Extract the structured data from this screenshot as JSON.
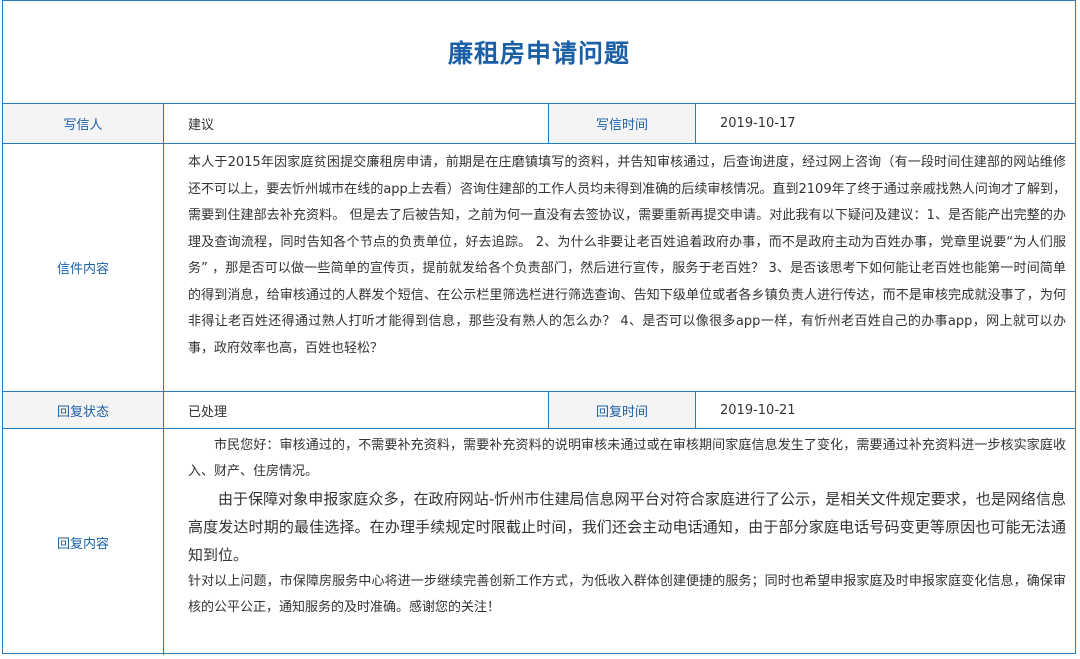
{
  "title": "廉租房申请问题",
  "writer": {
    "label": "写信人",
    "value": "建议",
    "time_label": "写信时间",
    "time_value": "2019-10-17"
  },
  "letter": {
    "label": "信件内容",
    "text": "本人于2015年因家庭贫困提交廉租房申请，前期是在庄磨镇填写的资料，并告知审核通过，后查询进度，经过网上咨询（有一段时间住建部的网站维修还不可以上，要去忻州城市在线的app上去看）咨询住建部的工作人员均未得到准确的后续审核情况。直到2109年了终于通过亲戚找熟人问询才了解到，需要到住建部去补充资料。 但是去了后被告知，之前为何一直没有去签协议，需要重新再提交申请。对此我有以下疑问及建议：1、是否能产出完整的办理及查询流程，同时告知各个节点的负责单位，好去追踪。 2、为什么非要让老百姓追着政府办事，而不是政府主动为百姓办事，党章里说要“为人们服务” ，那是否可以做一些简单的宣传页，提前就发给各个负责部门，然后进行宣传，服务于老百姓？ 3、是否该思考下如何能让老百姓也能第一时间简单的得到消息，给审核通过的人群发个短信、在公示栏里筛选栏进行筛选查询、告知下级单位或者各乡镇负责人进行传达，而不是审核完成就没事了，为何非得让老百姓还得通过熟人打听才能得到信息，那些没有熟人的怎么办？ 4、是否可以像很多app一样，有忻州老百姓自己的办事app，网上就可以办事，政府效率也高，百姓也轻松？"
  },
  "status": {
    "label": "回复状态",
    "value": "已处理",
    "time_label": "回复时间",
    "time_value": "2019-10-21"
  },
  "reply": {
    "label": "回复内容",
    "p1": "市民您好：审核通过的，不需要补充资料，需要补充资料的说明审核未通过或在审核期间家庭信息发生了变化，需要通过补充资料进一步核实家庭收入、财产、住房情况。",
    "p2": "由于保障对象申报家庭众多，在政府网站-忻州市住建局信息网平台对符合家庭进行了公示，是相关文件规定要求，也是网络信息高度发达时期的最佳选择。在办理手续规定时限截止时间，我们还会主动电话通知，由于部分家庭电话号码变更等原因也可能无法通知到位。",
    "p3": "针对以上问题，市保障房服务中心将进一步继续完善创新工作方式，为低收入群体创建便捷的服务；同时也希望申报家庭及时申报家庭变化信息，确保审核的公平公正，通知服务的及时准确。感谢您的关注！"
  }
}
